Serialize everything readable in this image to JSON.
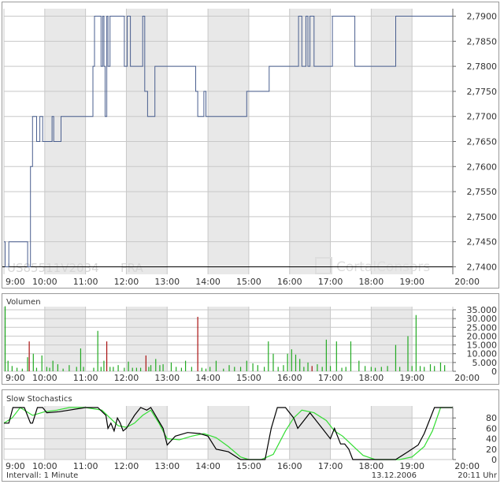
{
  "x_ticks": [
    "9:00",
    "10:00",
    "11:00",
    "12:00",
    "13:00",
    "14:00",
    "15:00",
    "16:00",
    "17:00",
    "18:00",
    "19:00",
    "20:00"
  ],
  "watermark": {
    "isin": "US85511V2034",
    "exchange": "FRA",
    "logo": "CortalConsors"
  },
  "footer": {
    "interval": "Intervall: 1 Minute",
    "date": "13.12.2006",
    "time": "20:11 Uhr"
  },
  "colors": {
    "price_line": "#4a5f8f",
    "volume_up": "#22aa22",
    "volume_down": "#aa1111",
    "stoch_k": "#000000",
    "stoch_d": "#33dd33",
    "shade": "#e8e8e8",
    "grid": "#c8c8c8"
  },
  "chart_data": [
    {
      "type": "line",
      "y_ticks": [
        "2,7900",
        "2,7850",
        "2,7800",
        "2,7750",
        "2,7700",
        "2,7650",
        "2,7600",
        "2,7550",
        "2,7500",
        "2,7450",
        "2,7400"
      ],
      "ylim": [
        2.7385,
        2.7915
      ],
      "xlim": [
        9.0,
        20.0
      ],
      "reference_line": 2.74,
      "x": [
        9.0,
        9.03,
        9.03,
        9.12,
        9.12,
        9.58,
        9.58,
        9.65,
        9.65,
        9.7,
        9.7,
        9.8,
        9.8,
        9.88,
        9.88,
        9.95,
        9.95,
        10.18,
        10.18,
        10.22,
        10.22,
        10.4,
        10.4,
        11.18,
        11.18,
        11.22,
        11.22,
        11.38,
        11.38,
        11.42,
        11.42,
        11.45,
        11.45,
        11.48,
        11.48,
        11.52,
        11.52,
        11.55,
        11.55,
        11.6,
        11.6,
        11.95,
        11.95,
        11.98,
        11.98,
        12.02,
        12.02,
        12.1,
        12.1,
        12.4,
        12.4,
        12.45,
        12.45,
        12.52,
        12.52,
        12.7,
        12.7,
        12.9,
        12.9,
        13.7,
        13.7,
        13.75,
        13.75,
        13.9,
        13.9,
        13.95,
        13.95,
        14.95,
        14.95,
        15.5,
        15.5,
        16.22,
        16.22,
        16.3,
        16.3,
        16.4,
        16.4,
        16.45,
        16.45,
        16.5,
        16.5,
        16.6,
        16.6,
        17.05,
        17.05,
        17.6,
        17.6,
        18.6,
        18.6,
        20.0
      ],
      "y": [
        2.745,
        2.745,
        2.74,
        2.74,
        2.745,
        2.745,
        2.74,
        2.74,
        2.76,
        2.76,
        2.77,
        2.77,
        2.765,
        2.765,
        2.77,
        2.77,
        2.765,
        2.765,
        2.77,
        2.77,
        2.765,
        2.765,
        2.77,
        2.77,
        2.78,
        2.78,
        2.79,
        2.79,
        2.78,
        2.78,
        2.79,
        2.79,
        2.78,
        2.78,
        2.77,
        2.77,
        2.79,
        2.79,
        2.78,
        2.78,
        2.79,
        2.79,
        2.78,
        2.78,
        2.78,
        2.78,
        2.79,
        2.79,
        2.78,
        2.78,
        2.79,
        2.79,
        2.775,
        2.775,
        2.77,
        2.77,
        2.78,
        2.78,
        2.78,
        2.78,
        2.775,
        2.775,
        2.77,
        2.77,
        2.775,
        2.775,
        2.77,
        2.77,
        2.775,
        2.775,
        2.78,
        2.78,
        2.79,
        2.79,
        2.78,
        2.78,
        2.79,
        2.79,
        2.78,
        2.78,
        2.79,
        2.79,
        2.78,
        2.78,
        2.79,
        2.79,
        2.78,
        2.78,
        2.79,
        2.79
      ]
    },
    {
      "type": "bar",
      "title": "Volumen",
      "y_ticks": [
        "35.000",
        "30.000",
        "25.000",
        "20.000",
        "15.000",
        "10.000",
        "5.000",
        "0"
      ],
      "ylim": [
        0,
        35000
      ],
      "xlim": [
        9.0,
        20.0
      ],
      "x": [
        9.03,
        9.1,
        9.2,
        9.32,
        9.45,
        9.58,
        9.62,
        9.72,
        9.8,
        9.93,
        10.05,
        10.12,
        10.2,
        10.32,
        10.45,
        10.6,
        10.78,
        10.88,
        10.95,
        11.2,
        11.3,
        11.38,
        11.45,
        11.52,
        11.6,
        11.68,
        11.8,
        11.95,
        12.05,
        12.15,
        12.25,
        12.35,
        12.48,
        12.55,
        12.6,
        12.72,
        12.82,
        12.9,
        13.1,
        13.22,
        13.35,
        13.45,
        13.6,
        13.75,
        13.85,
        13.95,
        14.05,
        14.2,
        14.38,
        14.52,
        14.65,
        14.8,
        14.95,
        15.1,
        15.22,
        15.38,
        15.48,
        15.6,
        15.72,
        15.85,
        15.95,
        16.05,
        16.15,
        16.25,
        16.35,
        16.45,
        16.55,
        16.68,
        16.8,
        16.9,
        17.0,
        17.15,
        17.28,
        17.38,
        17.5,
        17.7,
        17.85,
        18.0,
        18.1,
        18.25,
        18.4,
        18.6,
        18.7,
        18.9,
        19.0,
        19.1,
        19.2,
        19.3,
        19.45,
        19.55,
        19.7,
        19.8
      ],
      "values": [
        37000,
        6000,
        3000,
        2000,
        1500,
        8000,
        17000,
        10000,
        2000,
        9000,
        2500,
        2000,
        6000,
        4000,
        1500,
        3500,
        2500,
        13000,
        2500,
        2000,
        23000,
        2500,
        6000,
        17000,
        2500,
        2500,
        3500,
        2000,
        5500,
        2000,
        2000,
        2000,
        9000,
        2500,
        3500,
        7000,
        3500,
        4000,
        5000,
        2500,
        2000,
        6000,
        2500,
        31000,
        2000,
        1500,
        2500,
        6000,
        1500,
        3500,
        2500,
        2500,
        6000,
        4500,
        3500,
        2500,
        17000,
        10000,
        2500,
        3500,
        10000,
        12500,
        9500,
        7000,
        2500,
        5000,
        3000,
        4000,
        2500,
        18000,
        3000,
        17000,
        2000,
        2500,
        17000,
        6000,
        3000,
        2500,
        2000,
        2500,
        3000,
        15000,
        2500,
        20000,
        3000,
        32000,
        3000,
        2500,
        4000,
        3000,
        5000,
        3500
      ],
      "down": [
        false,
        false,
        false,
        false,
        false,
        false,
        true,
        false,
        false,
        false,
        false,
        false,
        false,
        false,
        false,
        false,
        false,
        false,
        false,
        false,
        false,
        false,
        false,
        true,
        false,
        false,
        false,
        false,
        false,
        false,
        false,
        false,
        true,
        false,
        false,
        false,
        false,
        false,
        false,
        false,
        false,
        false,
        false,
        true,
        false,
        false,
        false,
        false,
        false,
        false,
        false,
        false,
        false,
        false,
        false,
        false,
        false,
        false,
        false,
        false,
        false,
        false,
        false,
        false,
        false,
        false,
        true,
        false,
        false,
        false,
        false,
        false,
        false,
        false,
        false,
        false,
        false,
        false,
        false,
        false,
        false,
        false,
        false,
        false,
        false,
        false,
        false,
        false,
        false,
        false,
        false,
        false
      ]
    },
    {
      "type": "line",
      "title": "Slow Stochastics",
      "y_ticks": [
        "80",
        "60",
        "40",
        "20",
        "0"
      ],
      "ylim": [
        0,
        100
      ],
      "xlim": [
        9.0,
        20.0
      ],
      "series": [
        {
          "x": [
            9.0,
            9.12,
            9.22,
            9.5,
            9.65,
            9.7,
            9.82,
            9.95,
            10.05,
            10.35,
            11.0,
            11.3,
            11.5,
            11.55,
            11.62,
            11.7,
            11.78,
            11.85,
            11.92,
            12.0,
            12.2,
            12.35,
            12.5,
            12.6,
            12.9,
            13.0,
            13.2,
            13.5,
            13.8,
            14.0,
            14.2,
            14.5,
            14.8,
            15.0,
            15.4,
            15.55,
            15.7,
            15.9,
            16.1,
            16.2,
            16.35,
            16.5,
            16.65,
            16.8,
            17.0,
            17.1,
            17.25,
            17.35,
            17.45,
            17.55,
            17.7,
            18.0,
            18.3,
            18.6,
            18.9,
            19.15,
            19.3,
            19.55,
            19.65,
            20.0
          ],
          "y": [
            70,
            70,
            100,
            100,
            70,
            70,
            100,
            100,
            90,
            92,
            100,
            100,
            85,
            60,
            70,
            55,
            80,
            70,
            55,
            60,
            85,
            100,
            95,
            100,
            60,
            28,
            45,
            52,
            50,
            45,
            20,
            15,
            0,
            0,
            0,
            60,
            100,
            100,
            80,
            60,
            75,
            90,
            75,
            60,
            40,
            60,
            30,
            30,
            20,
            0,
            0,
            0,
            0,
            0,
            15,
            28,
            50,
            100,
            100,
            100
          ]
        },
        {
          "x": [
            9.0,
            9.2,
            9.4,
            9.7,
            10.0,
            10.3,
            10.6,
            11.0,
            11.4,
            11.6,
            11.8,
            12.0,
            12.2,
            12.4,
            12.6,
            12.8,
            13.0,
            13.3,
            13.6,
            13.9,
            14.2,
            14.5,
            14.8,
            15.0,
            15.3,
            15.6,
            15.9,
            16.1,
            16.3,
            16.6,
            16.9,
            17.1,
            17.3,
            17.5,
            17.8,
            18.1,
            18.4,
            18.7,
            19.0,
            19.3,
            19.5,
            19.7,
            20.0
          ],
          "y": [
            70,
            80,
            100,
            85,
            92,
            95,
            100,
            100,
            95,
            80,
            65,
            62,
            70,
            85,
            95,
            70,
            40,
            38,
            45,
            50,
            42,
            25,
            5,
            0,
            0,
            10,
            55,
            80,
            95,
            90,
            75,
            55,
            45,
            30,
            8,
            0,
            0,
            0,
            5,
            25,
            55,
            100,
            100
          ]
        }
      ]
    }
  ]
}
